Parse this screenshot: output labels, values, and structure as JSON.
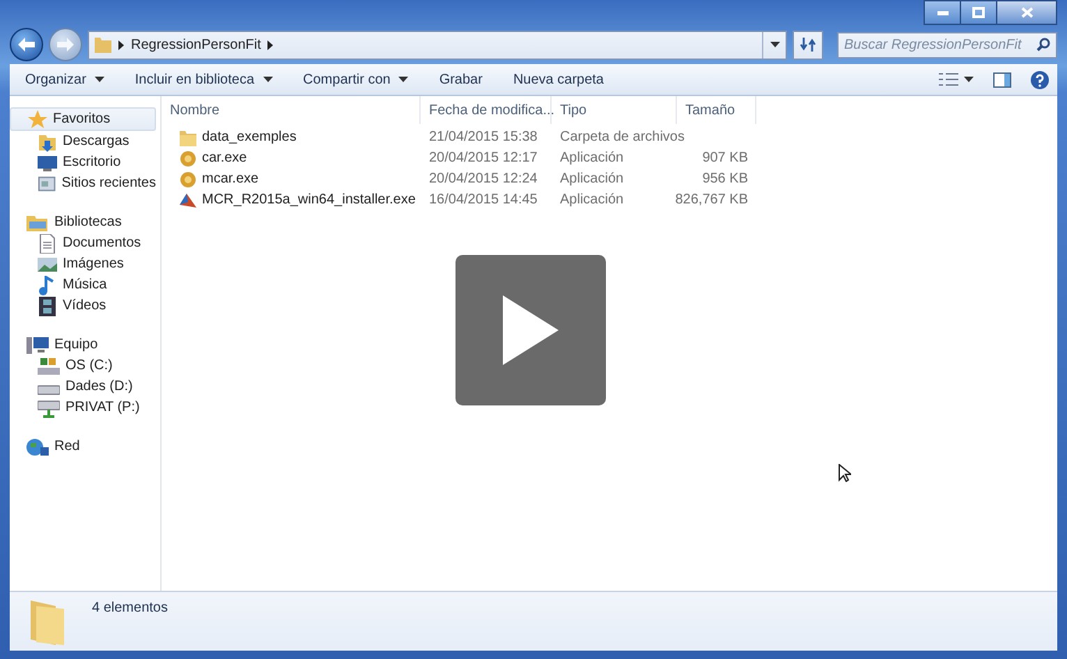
{
  "address": {
    "crumbs": [
      "RegressionPersonFit"
    ]
  },
  "search": {
    "placeholder": "Buscar RegressionPersonFit"
  },
  "toolbar": [
    {
      "label": "Organizar",
      "dropdown": true
    },
    {
      "label": "Incluir en biblioteca",
      "dropdown": true
    },
    {
      "label": "Compartir con",
      "dropdown": true
    },
    {
      "label": "Grabar",
      "dropdown": false
    },
    {
      "label": "Nueva carpeta",
      "dropdown": false
    }
  ],
  "sidebar": [
    {
      "label": "Favoritos",
      "kind": "star",
      "selected": true,
      "children": [
        {
          "label": "Descargas",
          "kind": "downloads",
          "selected": false
        },
        {
          "label": "Escritorio",
          "kind": "desktop",
          "selected": false
        },
        {
          "label": "Sitios recientes",
          "kind": "recent",
          "selected": false
        }
      ]
    },
    {
      "label": "Bibliotecas",
      "kind": "library",
      "selected": false,
      "children": [
        {
          "label": "Documentos",
          "kind": "document",
          "selected": false
        },
        {
          "label": "Imágenes",
          "kind": "pictures",
          "selected": false
        },
        {
          "label": "Música",
          "kind": "music",
          "selected": false
        },
        {
          "label": "Vídeos",
          "kind": "videos",
          "selected": false
        }
      ]
    },
    {
      "label": "Equipo",
      "kind": "computer",
      "selected": false,
      "children": [
        {
          "label": "OS (C:)",
          "kind": "system-drive",
          "selected": false
        },
        {
          "label": "Dades (D:)",
          "kind": "drive",
          "selected": false
        },
        {
          "label": "PRIVAT (P:)",
          "kind": "network-drive",
          "selected": false
        }
      ]
    },
    {
      "label": "Red",
      "kind": "network",
      "selected": false
    }
  ],
  "table": {
    "columns": [
      "Nombre",
      "Fecha de modifica...",
      "Tipo",
      "Tamaño"
    ],
    "rows": [
      {
        "kind": "folder",
        "name": "data_exemples",
        "date": "21/04/2015 15:38",
        "type": "Carpeta de archivos"
      },
      {
        "kind": "app",
        "name": "car.exe",
        "date": "20/04/2015 12:17",
        "type": "Aplicación",
        "size": "907 KB"
      },
      {
        "kind": "app",
        "name": "mcar.exe",
        "date": "20/04/2015 12:24",
        "type": "Aplicación",
        "size": "956 KB"
      },
      {
        "kind": "installer",
        "name": "MCR_R2015a_win64_installer.exe",
        "date": "16/04/2015 14:45",
        "type": "Aplicación",
        "size": "826,767 KB"
      }
    ]
  },
  "status_bar": {
    "count": "4 elementos"
  }
}
